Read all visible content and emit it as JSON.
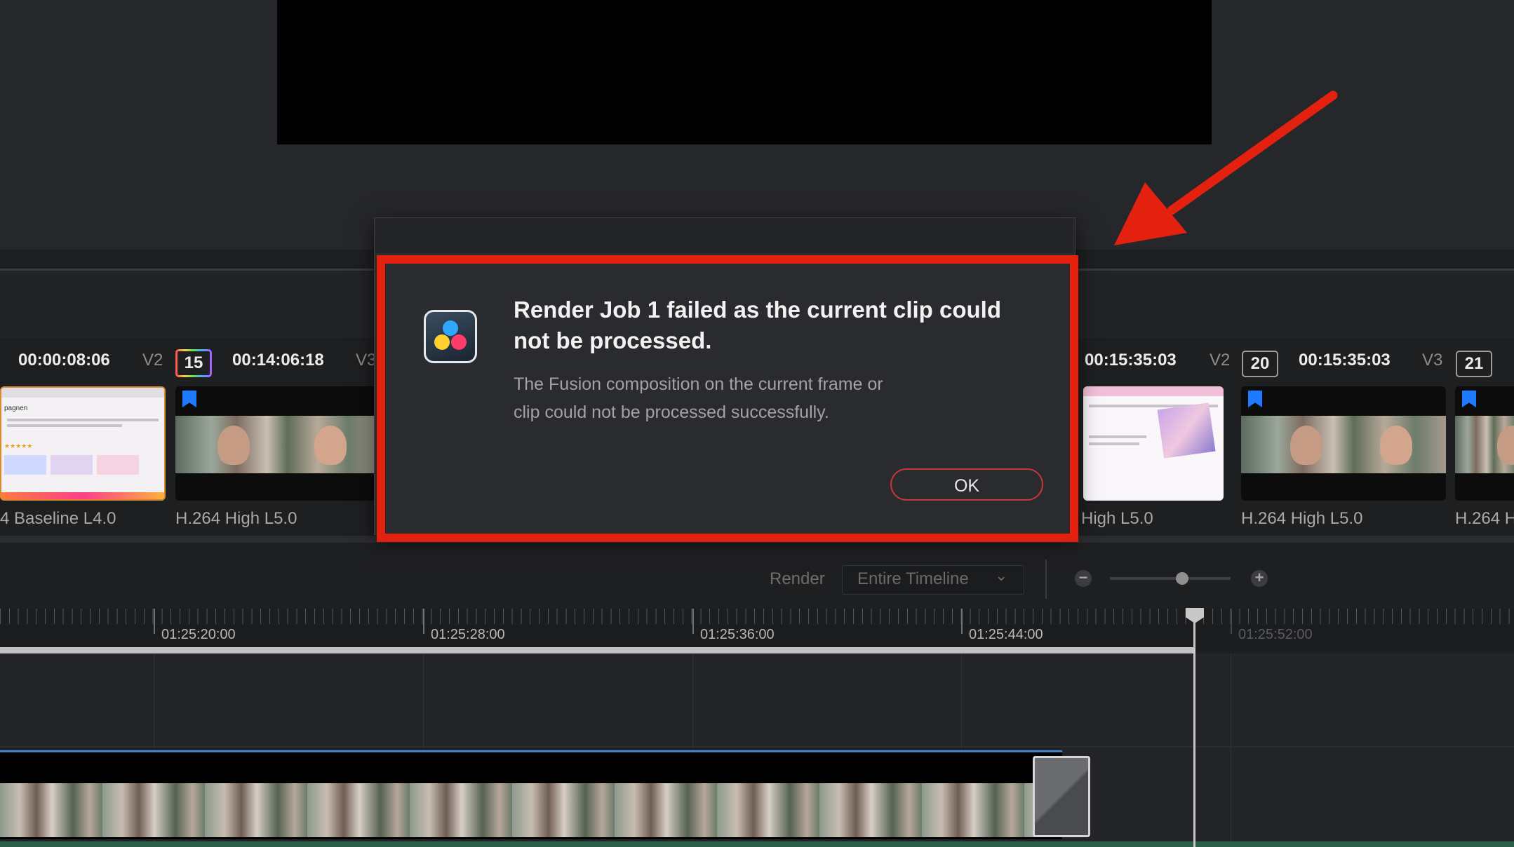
{
  "clip_strip": {
    "clips_left": [
      {
        "timecode": "00:00:08:06",
        "track": "V2",
        "codec": "4 Baseline L4.0"
      },
      {
        "index": "15",
        "timecode": "00:14:06:18",
        "track": "V3",
        "codec": "H.264 High L5.0"
      }
    ],
    "clips_right": [
      {
        "timecode": "00:15:35:03",
        "track": "V2",
        "codec": "High L5.0"
      },
      {
        "index": "20",
        "timecode": "00:15:35:03",
        "track": "V3",
        "codec": "H.264 High L5.0"
      },
      {
        "index": "21",
        "codec": "H.264 H"
      }
    ],
    "web_thumb": {
      "heading": "pagnen",
      "rating": "★★★★★"
    }
  },
  "render_bar": {
    "label": "Render",
    "range_value": "Entire Timeline"
  },
  "timeline": {
    "ruler_labels": [
      "01:25:20:00",
      "01:25:28:00",
      "01:25:36:00",
      "01:25:44:00",
      "01:25:52:00"
    ]
  },
  "dialog": {
    "title": "Render Job 1 failed as the current clip could not be processed.",
    "message": "The Fusion composition on the current frame or clip could not be processed successfully.",
    "ok_label": "OK"
  },
  "icons": [
    "davinci-resolve-app-icon",
    "chevron-down-icon",
    "zoom-out-icon",
    "zoom-in-icon",
    "bookmark-flag-icon",
    "arrow-annotation"
  ],
  "colors": {
    "annotation_red": "#e4210f",
    "ok_border": "#c8343a",
    "bookmark_blue": "#1e7bff",
    "clip_outline_blue": "#3a86c8"
  }
}
